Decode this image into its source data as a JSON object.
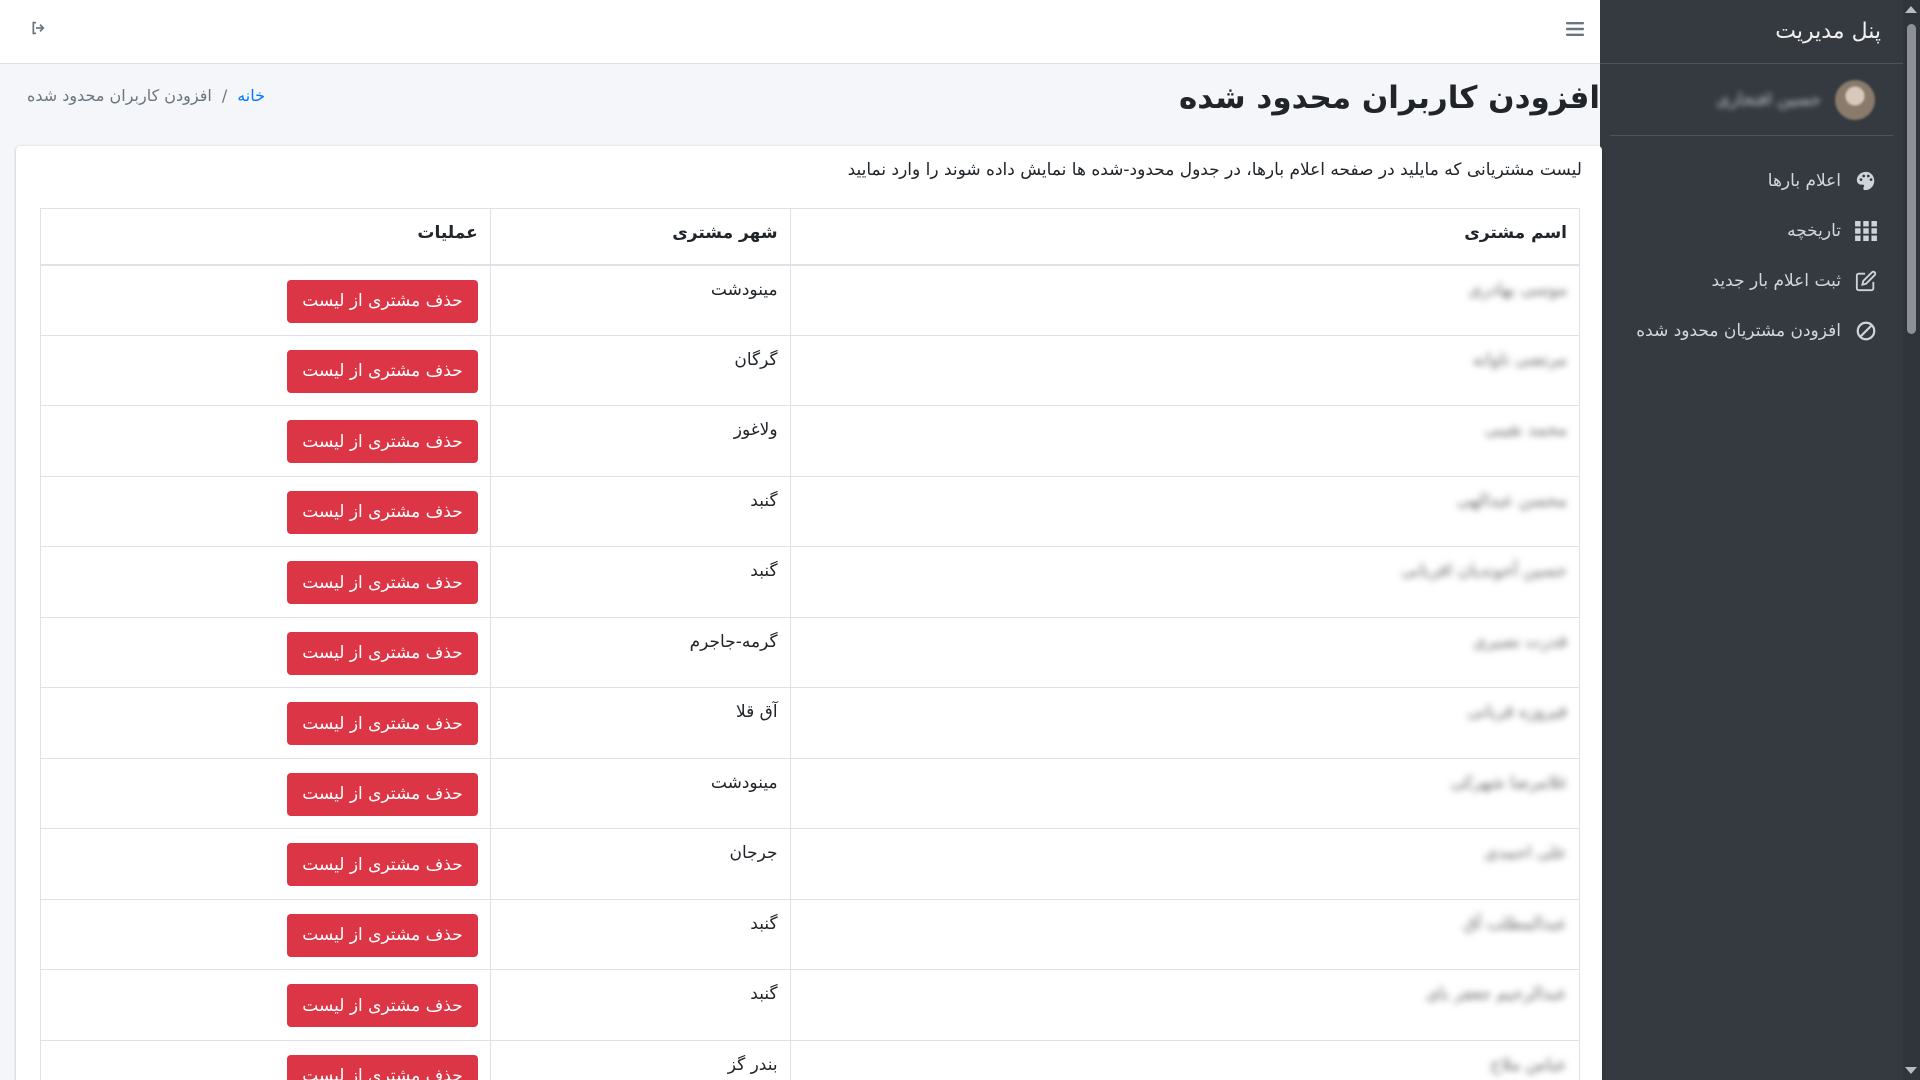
{
  "sidebar": {
    "brand": "پنل مدیریت",
    "user_name": "حسین افتخاری",
    "items": [
      {
        "label": "اعلام بارها",
        "icon": "palette-icon"
      },
      {
        "label": "تاریخچه",
        "icon": "grid-icon"
      },
      {
        "label": "ثبت اعلام بار جدید",
        "icon": "edit-icon"
      },
      {
        "label": "افزودن مشتریان محدود شده",
        "icon": "ban-icon"
      }
    ]
  },
  "page": {
    "title": "افزودن کاربران محدود شده",
    "breadcrumb_home": "خانه",
    "breadcrumb_separator": "/",
    "breadcrumb_current": "افزودن کاربران محدود شده",
    "description": "لیست مشتریانی که مایلید در صفحه اعلام بارها، در جدول محدود-شده ها نمایش داده شوند را وارد نمایید"
  },
  "table": {
    "headers": {
      "name": "اسم مشتری",
      "city": "شهر مشتری",
      "ops": "عملیات"
    },
    "delete_label": "حذف مشتری از لیست",
    "rows": [
      {
        "name": "موسی بهادری",
        "city": "مینودشت"
      },
      {
        "name": "مرتضی تاوانه",
        "city": "گرگان"
      },
      {
        "name": "محمد نقیبی",
        "city": "ولاغوز"
      },
      {
        "name": "محسن عبدالهی",
        "city": "گنبد"
      },
      {
        "name": "حسین آخوندیان اقربانی",
        "city": "گنبد"
      },
      {
        "name": "قدرت نصیری",
        "city": "گرمه-جاجرم"
      },
      {
        "name": "فیروزه قربانی",
        "city": "آق قلا"
      },
      {
        "name": "غلامرضا شهرکی",
        "city": "مینودشت"
      },
      {
        "name": "علی احمدی",
        "city": "جرجان"
      },
      {
        "name": "عبدالمطلب آق",
        "city": "گنبد"
      },
      {
        "name": "عبدالرحیم جعفر بای",
        "city": "گنبد"
      },
      {
        "name": "عباس ملاح",
        "city": "بندر گز"
      }
    ]
  }
}
